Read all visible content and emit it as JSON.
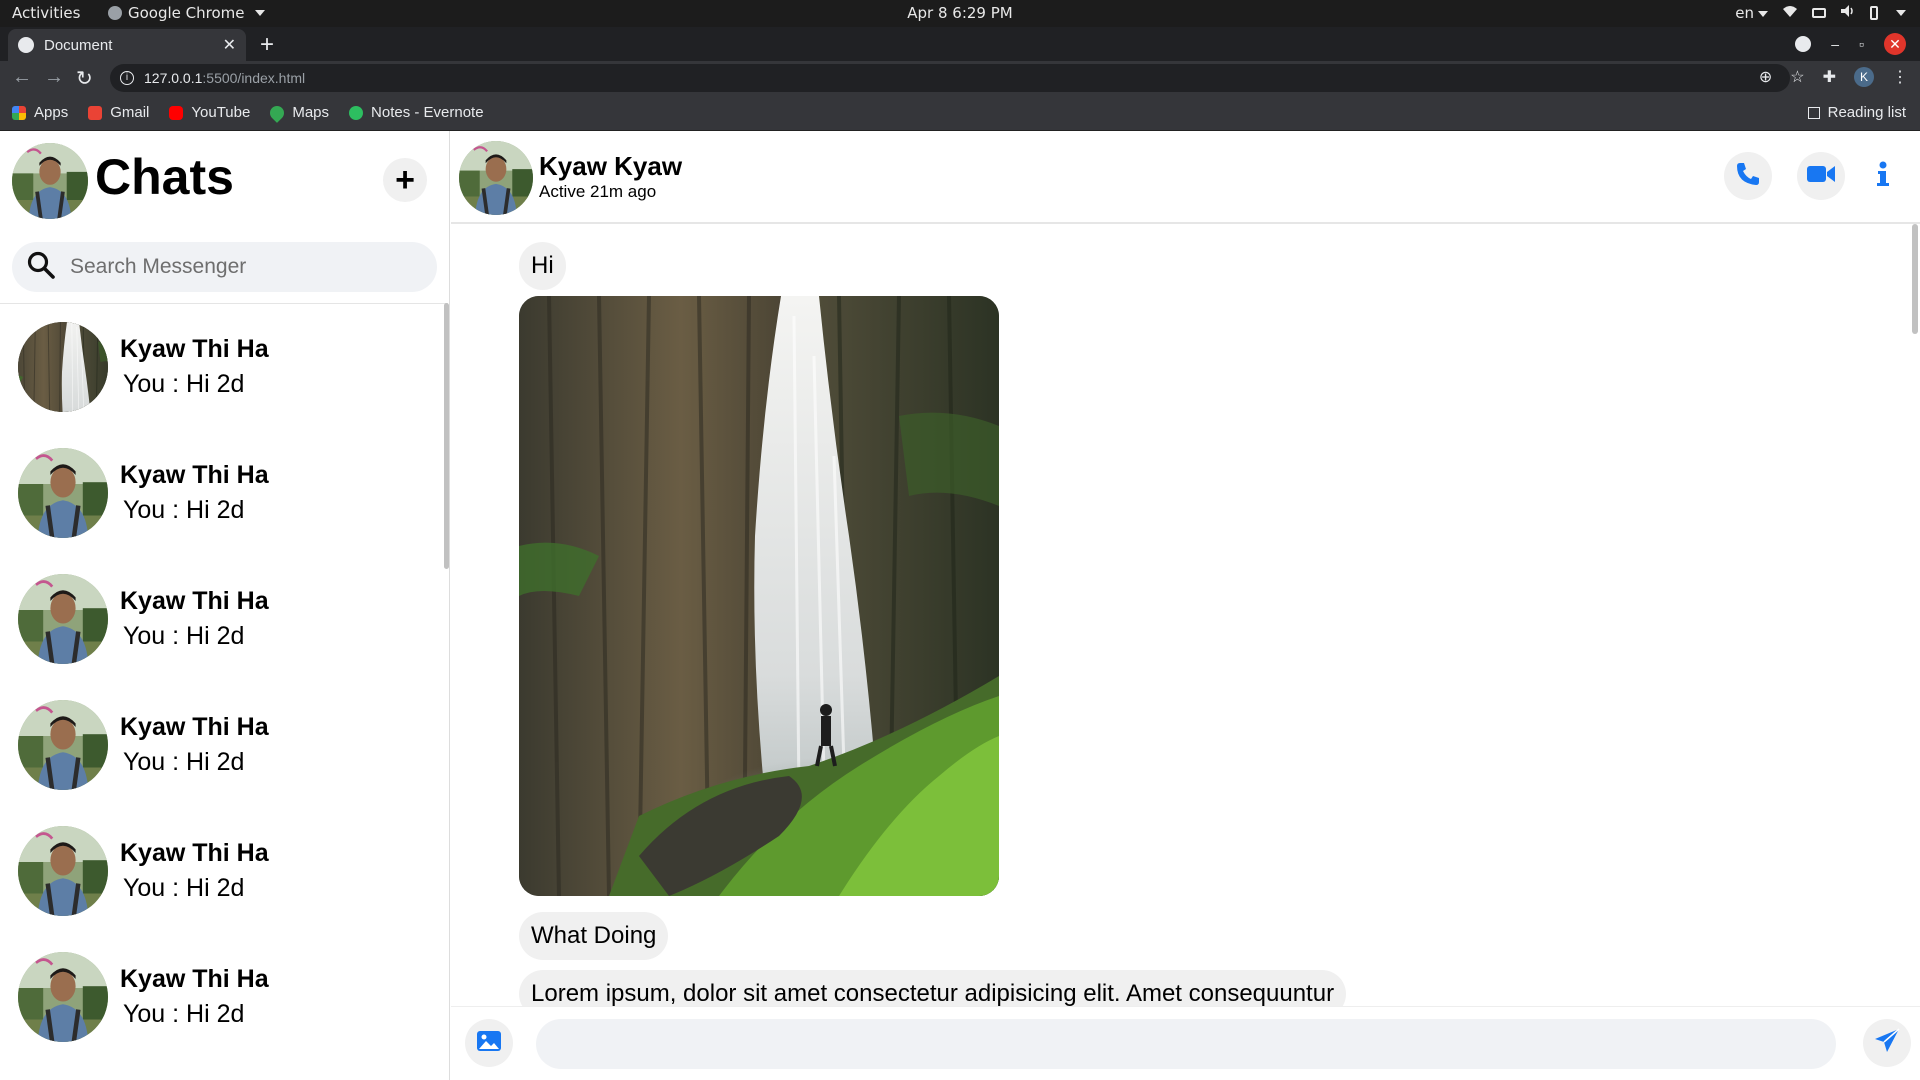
{
  "os_bar": {
    "activities": "Activities",
    "app_name": "Google Chrome",
    "clock": "Apr 8  6:29 PM",
    "lang": "en"
  },
  "browser": {
    "tab_title": "Document",
    "url_host": "127.0.0.1",
    "url_path": ":5500/index.html",
    "bookmarks": [
      {
        "label": "Apps",
        "color": "#e94235"
      },
      {
        "label": "Gmail",
        "color": "#ea4335"
      },
      {
        "label": "YouTube",
        "color": "#ff0000"
      },
      {
        "label": "Maps",
        "color": "#34a853"
      },
      {
        "label": "Notes - Evernote",
        "color": "#2dbe60"
      }
    ],
    "reading_list": "Reading list",
    "profile_initial": "K"
  },
  "sidebar": {
    "title": "Chats",
    "add_label": "+",
    "search_placeholder": "Search Messenger",
    "chats": [
      {
        "name": "Kyaw Thi Ha",
        "preview": "You : Hi 2d",
        "avatar": "waterfall"
      },
      {
        "name": "Kyaw Thi Ha",
        "preview": "You : Hi 2d",
        "avatar": "person"
      },
      {
        "name": "Kyaw Thi Ha",
        "preview": "You : Hi 2d",
        "avatar": "person"
      },
      {
        "name": "Kyaw Thi Ha",
        "preview": "You : Hi 2d",
        "avatar": "person"
      },
      {
        "name": "Kyaw Thi Ha",
        "preview": "You : Hi 2d",
        "avatar": "person"
      },
      {
        "name": "Kyaw Thi Ha",
        "preview": "You : Hi 2d",
        "avatar": "person"
      }
    ]
  },
  "conversation": {
    "peer_name": "Kyaw Kyaw",
    "peer_status": "Active 21m ago",
    "messages": [
      {
        "type": "text",
        "text": "Hi"
      },
      {
        "type": "image",
        "alt": "waterfall"
      },
      {
        "type": "text",
        "text": "What Doing"
      },
      {
        "type": "text",
        "text": "Lorem ipsum, dolor sit amet consectetur adipisicing elit. Amet consequuntur"
      }
    ],
    "composer_value": ""
  },
  "colors": {
    "accent": "#1877f2",
    "bubble_bg": "#f0f0f0"
  }
}
